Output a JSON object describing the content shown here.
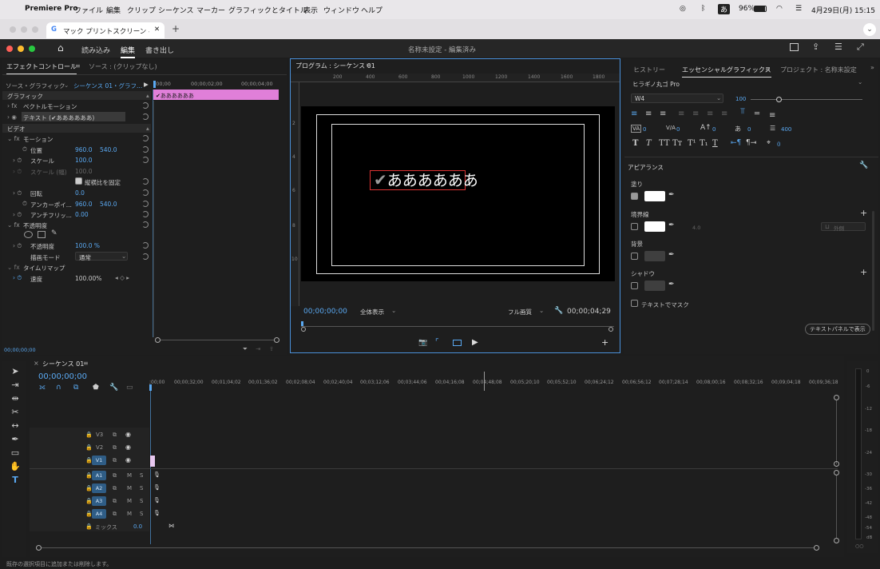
{
  "menubar": {
    "app_name": "Premiere Pro",
    "items": [
      "ファイル",
      "編集",
      "クリップ",
      "シーケンス",
      "マーカー",
      "グラフィックとタイトル",
      "表示",
      "ウィンドウ",
      "ヘルプ"
    ],
    "battery": "96%",
    "ime": "あ",
    "datetime": "4月29日(月) 15:15"
  },
  "browser_tab": {
    "title": "マック プリントスクリーン - Go",
    "close": "✕",
    "new_tab": "+"
  },
  "app_header": {
    "tabs": [
      "読み込み",
      "編集",
      "書き出し"
    ],
    "active_tab": "編集",
    "title": "名称未設定 - 編集済み"
  },
  "effect_controls": {
    "tabs": [
      "エフェクトコントロール",
      "ソース : (クリップなし)"
    ],
    "source_label": "ソース・グラフィック",
    "sequence_label": "シーケンス 01・グラフ...",
    "ruler_times": [
      ";00;00",
      "00;00;02;00",
      "00;00;04;00"
    ],
    "clip_name": "✔ああああああ",
    "section_graphic": "グラフィック",
    "vector_motion": "ベクトルモーション",
    "text_layer": "テキスト (✔ああああああ)",
    "section_video": "ビデオ",
    "motion": "モーション",
    "position": {
      "label": "位置",
      "x": "960.0",
      "y": "540.0"
    },
    "scale": {
      "label": "スケール",
      "value": "100.0"
    },
    "scale_width": {
      "label": "スケール (幅)",
      "value": "100.0"
    },
    "uniform_scale": "縦横比を固定",
    "rotation": {
      "label": "回転",
      "value": "0.0"
    },
    "anchor": {
      "label": "アンカーポイ...",
      "x": "960.0",
      "y": "540.0"
    },
    "antiflicker": {
      "label": "アンチフリッ...",
      "value": "0.00"
    },
    "opacity_section": "不透明度",
    "opacity": {
      "label": "不透明度",
      "value": "100.0 %"
    },
    "blend_mode": {
      "label": "描画モード",
      "value": "通常"
    },
    "time_remap": "タイムリマップ",
    "speed": {
      "label": "速度",
      "value": "100.00%"
    },
    "timecode": "00;00;00;00"
  },
  "program_monitor": {
    "title": "プログラム : シーケンス 01",
    "ruler_top": [
      "200",
      "400",
      "600",
      "800",
      "1000",
      "1200",
      "1400",
      "1600",
      "1800"
    ],
    "ruler_left": [
      "2",
      "4",
      "6",
      "8",
      "10"
    ],
    "canvas_text": "ああああああ",
    "timecode": "00;00;00;00",
    "zoom": "全体表示",
    "quality": "フル画質",
    "duration": "00;00;04;29"
  },
  "essential_graphics": {
    "tabs": [
      "ヒストリー",
      "エッセンシャルグラフィックス",
      "プロジェクト : 名称未設定"
    ],
    "font": "ヒラギノ丸ゴ Pro",
    "weight": "W4",
    "size": "100",
    "tracking": "0",
    "kerning": "0",
    "baseline": "0",
    "tsume": "0",
    "leading": "400",
    "style_buttons": [
      "T",
      "T",
      "TT",
      "Tт",
      "T¹",
      "T₁",
      "T"
    ],
    "appearance": "アピアランス",
    "fill": "塗り",
    "stroke": "境界線",
    "stroke_width": "4.0",
    "stroke_pos": "外側",
    "background": "背景",
    "shadow": "シャドウ",
    "mask_text": "テキストでマスク",
    "show_in_text_panel": "テキストパネルで表示"
  },
  "timeline": {
    "tab": "シーケンス 01",
    "timecode": "00;00;00;00",
    "ruler": [
      ";00;00",
      "00;00;32;00",
      "00;01;04;02",
      "00;01;36;02",
      "00;02;08;04",
      "00;02;40;04",
      "00;03;12;06",
      "00;03;44;06",
      "00;04;16;08",
      "00;04;48;08",
      "00;05;20;10",
      "00;05;52;10",
      "00;06;24;12",
      "00;06;56;12",
      "00;07;28;14",
      "00;08;00;16",
      "00;08;32;16",
      "00;09;04;18",
      "00;09;36;18"
    ],
    "video_tracks": [
      "V3",
      "V2",
      "V1"
    ],
    "audio_tracks": [
      "A1",
      "A2",
      "A3",
      "A4"
    ],
    "mix_label": "ミックス",
    "mix_value": "0.0",
    "meter_labels": [
      "0",
      "-6",
      "-12",
      "-18",
      "-24",
      "-30",
      "-36",
      "-42",
      "-48",
      "-54",
      "dB"
    ]
  },
  "status_bar": "既存の選択項目に追加または削除します。",
  "colors": {
    "accent": "#5aa9f2",
    "clip": "#e07fd9",
    "panel_border": "#4a90d9"
  }
}
